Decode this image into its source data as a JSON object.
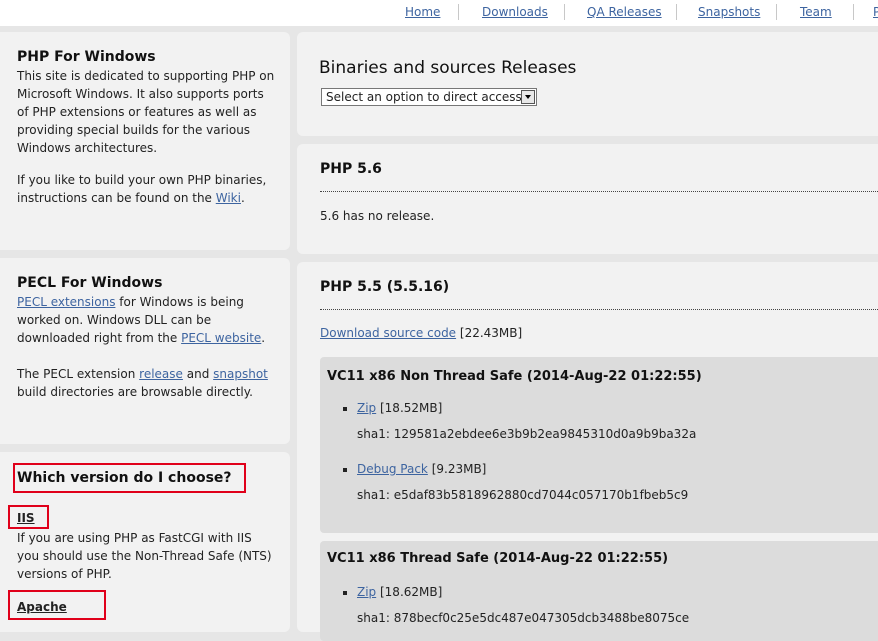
{
  "nav": {
    "items": [
      "Home",
      "Downloads",
      "QA Releases",
      "Snapshots",
      "Team",
      "P"
    ]
  },
  "php_windows": {
    "title": "PHP For Windows",
    "desc": [
      "This site is dedicated to supporting PHP on",
      "Microsoft Windows. It also supports ports",
      "of PHP extensions or features as well as",
      "providing special builds for the various",
      "Windows architectures."
    ],
    "build_line1": "If you like to build your own PHP binaries,",
    "build_line2_pre": "instructions can be found on the ",
    "wiki_link": "Wiki",
    "build_line2_post": "."
  },
  "pecl": {
    "title": "PECL For Windows",
    "ext_link": "PECL extensions",
    "line1_post": " for Windows is being",
    "line2": "worked on. Windows DLL can be",
    "line3_pre": "downloaded right from the ",
    "website_link": "PECL website",
    "line3_post": ".",
    "line4_pre": "The PECL extension ",
    "release_link": "release",
    "line4_mid": " and ",
    "snapshot_link": "snapshot",
    "line5": "build directories are browsable directly."
  },
  "choose": {
    "title": "Which version do I choose?",
    "iis_heading": "IIS",
    "iis_text": [
      "If you are using PHP as FastCGI with IIS",
      "you should use the Non-Thread Safe (NTS)",
      "versions of PHP."
    ],
    "apache_heading": "Apache"
  },
  "releases": {
    "title": "Binaries and sources Releases",
    "select_value": "Select an option to direct access..."
  },
  "php56": {
    "title": "PHP 5.6",
    "text": "5.6 has no release."
  },
  "php55": {
    "title": "PHP 5.5 (5.5.16)",
    "source_link": "Download source code",
    "source_size": " [22.43MB]",
    "builds": [
      {
        "title": "VC11 x86 Non Thread Safe (2014-Aug-22 01:22:55)",
        "zip_link": "Zip",
        "zip_size": " [18.52MB]",
        "zip_sha": "sha1: 129581a2ebdee6e3b9b2ea9845310d0a9b9ba32a",
        "debug_link": "Debug Pack",
        "debug_size": " [9.23MB]",
        "debug_sha": "sha1: e5daf83b5818962880cd7044c057170b1fbeb5c9"
      },
      {
        "title": "VC11 x86 Thread Safe (2014-Aug-22 01:22:55)",
        "zip_link": "Zip",
        "zip_size": " [18.62MB]",
        "zip_sha": "sha1: 878becf0c25e5dc487e047305dcb3488be8075ce"
      }
    ]
  }
}
